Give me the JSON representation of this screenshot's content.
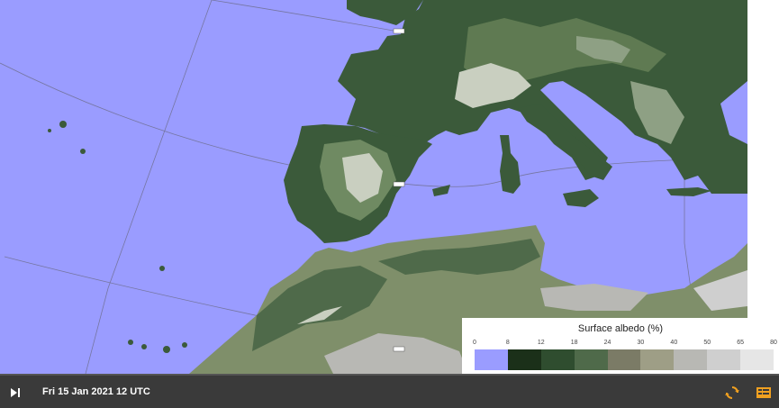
{
  "map": {
    "parameter": "Surface albedo",
    "water_color": "#9a9cff",
    "land_dark_color": "#3b5a3a",
    "land_mid_color": "#7f8f6a",
    "land_light_color": "#d8d8d8",
    "city_markers": [
      "label",
      "label",
      "label"
    ]
  },
  "legend": {
    "title": "Surface albedo (%)",
    "ticks": [
      "0",
      "8",
      "12",
      "18",
      "24",
      "30",
      "40",
      "50",
      "65",
      "80"
    ],
    "colors": [
      "#9a9cff",
      "#1b3019",
      "#2f4d2f",
      "#4f6a4a",
      "#7b7b66",
      "#9e9e86",
      "#b8b8b4",
      "#cfcfcf",
      "#e6e6e6"
    ]
  },
  "bottombar": {
    "timestamp": "Fri 15 Jan 2021 12 UTC",
    "play_icon": "skip-forward-icon",
    "refresh_icon": "refresh-icon",
    "layers_icon": "layers-icon",
    "accent_color": "#f0a020"
  }
}
